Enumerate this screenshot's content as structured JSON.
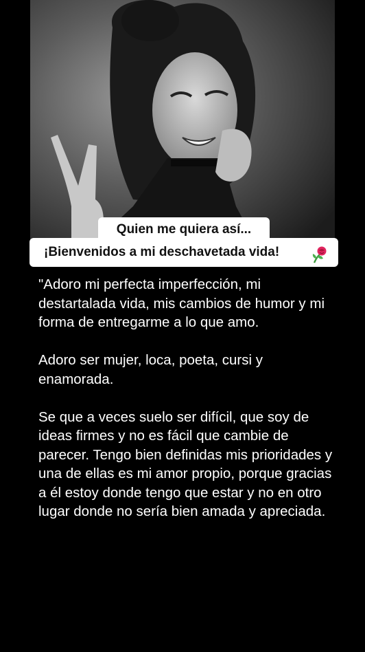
{
  "caption": {
    "line1": "Quien me quiera así...",
    "line2": "¡Bienvenidos a mi deschavetada vida!",
    "emoji": "rose-icon"
  },
  "post": {
    "paragraphs": [
      "\"Adoro mi perfecta imperfección, mi destartalada vida, mis cambios de humor y mi forma de entregarme a lo que amo.",
      "Adoro ser mujer, loca, poeta, cursi y enamorada.",
      "Se que a veces suelo ser difícil, que soy de ideas firmes y no es fácil que cambie de parecer. Tengo bien definidas mis prioridades y una de ellas es mi amor propio, porque gracias a él estoy donde tengo que estar y no en otro lugar donde no sería bien amada y apreciada."
    ]
  },
  "colors": {
    "background": "#000000",
    "text": "#ffffff",
    "caption_bg": "#ffffff",
    "caption_text": "#111111"
  }
}
